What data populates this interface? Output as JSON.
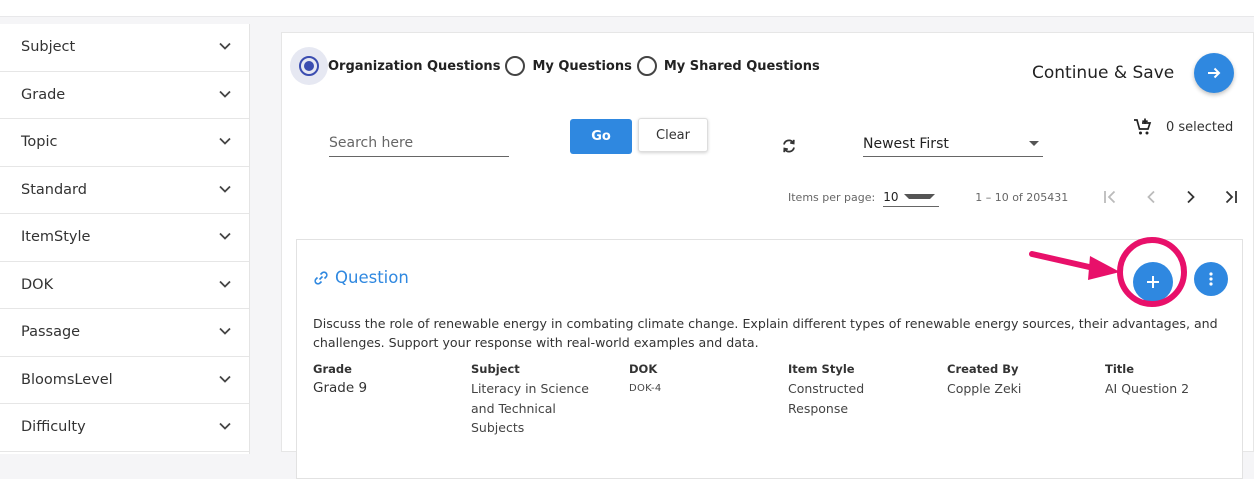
{
  "sidebar": {
    "filters": [
      {
        "label": "Subject"
      },
      {
        "label": "Grade"
      },
      {
        "label": "Topic"
      },
      {
        "label": "Standard"
      },
      {
        "label": "ItemStyle"
      },
      {
        "label": "DOK"
      },
      {
        "label": "Passage"
      },
      {
        "label": "BloomsLevel"
      },
      {
        "label": "Difficulty"
      }
    ]
  },
  "main": {
    "question_source": {
      "options": [
        "Organization Questions",
        "My Questions",
        "My Shared Questions"
      ],
      "selected": "Organization Questions"
    },
    "continue_label": "Continue & Save",
    "search_placeholder": "Search here",
    "go_label": "Go",
    "clear_label": "Clear",
    "sort_value": "Newest First",
    "selected_count": "0 selected",
    "pagination": {
      "items_per_page_label": "Items per page:",
      "items_per_page": "10",
      "range": "1 – 10 of 205431"
    },
    "question": {
      "title": "Question",
      "description": "Discuss the role of renewable energy in combating climate change. Explain different types of renewable energy sources, their advantages, and challenges. Support your response with real-world examples and data.",
      "meta": [
        {
          "label": "Grade",
          "value": "Grade 9"
        },
        {
          "label": "Subject",
          "value": "Literacy in Science and Technical Subjects"
        },
        {
          "label": "DOK",
          "value": "DOK-4"
        },
        {
          "label": "Item Style",
          "value": "Constructed Response"
        },
        {
          "label": "Created By",
          "value": "Copple Zeki"
        },
        {
          "label": "Title",
          "value": "AI Question 2"
        }
      ]
    }
  },
  "colors": {
    "accent": "#2f88e0",
    "radio_selected": "#3b4db0",
    "annotation": "#e8106a"
  },
  "icons": {
    "filter_toggle": "chevron-down-icon",
    "continue": "arrow-right-icon",
    "refresh": "refresh-icon",
    "cart": "cart-add-icon",
    "question_link": "link-icon",
    "add": "plus-icon",
    "more": "more-vertical-icon"
  }
}
